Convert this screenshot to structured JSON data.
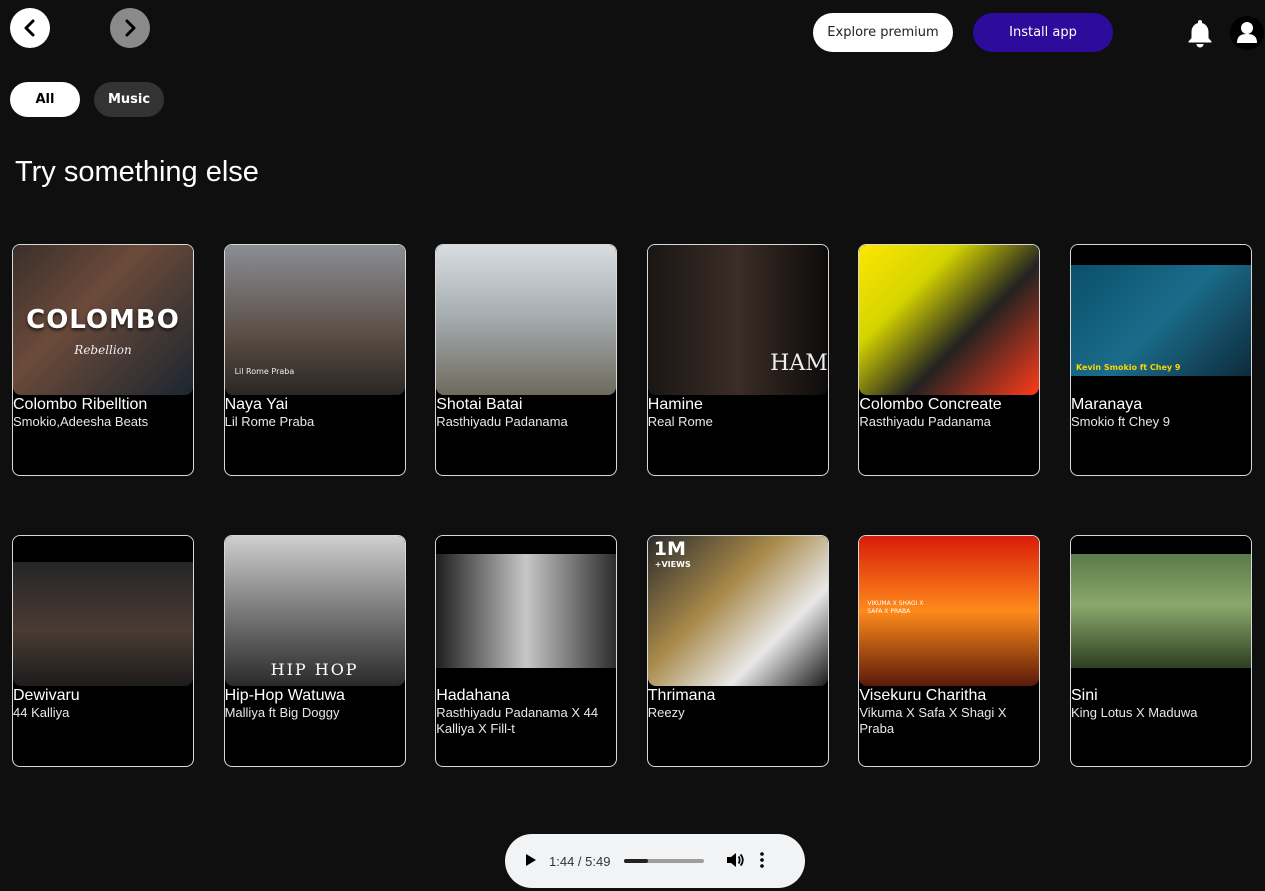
{
  "header": {
    "explore_label": "Explore premium",
    "install_label": "Install app"
  },
  "filters": {
    "all": "All",
    "music": "Music"
  },
  "section": {
    "title": "Try something else"
  },
  "cards": [
    {
      "title": "Colombo Ribelltion",
      "artist": "Smokio,Adeesha Beats",
      "cover_text": "COLOMBO",
      "cover_sub": "Rebellion",
      "bg": "linear-gradient(135deg,#3a2f2a,#6b4a3a 40%,#1b2630)"
    },
    {
      "title": "Naya Yai",
      "artist": "Lil Rome Praba",
      "cover_text": "",
      "cover_sub": "Lil Rome Praba",
      "bg": "linear-gradient(180deg,#8a8e94,#5a4e45 60%,#2b2622)"
    },
    {
      "title": "Shotai Batai",
      "artist": "Rasthiyadu Padanama",
      "cover_text": "",
      "cover_sub": "",
      "bg": "linear-gradient(180deg,#d9dde0,#a8b0b4 45%,#6e6a5c)"
    },
    {
      "title": "Hamine",
      "artist": "Real Rome",
      "cover_text": "HAM",
      "cover_sub": "",
      "bg": "linear-gradient(90deg,#1a1614,#3b2d27 50%,#0d0b0a)"
    },
    {
      "title": "Colombo Concreate",
      "artist": "Rasthiyadu Padanama",
      "cover_text": "",
      "cover_sub": "",
      "bg": "linear-gradient(135deg,#ffe600,#d4d400 30%,#222 60%,#ff3b1a)"
    },
    {
      "title": "Maranaya",
      "artist": "Smokio ft Chey 9",
      "cover_text": "",
      "cover_sub": "Kevin Smokio ft Chey 9",
      "bg": "linear-gradient(135deg,#0a4f6a,#1a6c8a 50%,#0e2a3a)"
    },
    {
      "title": "Dewivaru",
      "artist": "44 Kalliya",
      "cover_text": "",
      "cover_sub": "",
      "bg": "linear-gradient(180deg,#262626,#4a3b33 55%,#1c1c1c)"
    },
    {
      "title": "Hip-Hop Watuwa",
      "artist": "Malliya ft Big Doggy",
      "cover_text": "HIP HOP",
      "cover_sub": "",
      "bg": "linear-gradient(180deg,#cfcfcf,#7a7a7a 50%,#2a2a2a)"
    },
    {
      "title": "Hadahana",
      "artist": "Rasthiyadu Padanama X 44 Kalliya X Fill-t",
      "cover_text": "",
      "cover_sub": "",
      "bg": "linear-gradient(90deg,#1e1e1e,#c7c7c7 50%,#2c2c2c)"
    },
    {
      "title": "Thrimana",
      "artist": "Reezy",
      "cover_text": "1M",
      "cover_sub": "+VIEWS",
      "bg": "linear-gradient(135deg,#2b2b2b,#a88a4a 40%,#e8e8e8 70%,#1a1a1a)"
    },
    {
      "title": "Visekuru Charitha",
      "artist": "Vikuma X Safa X Shagi X Praba",
      "cover_text": "",
      "cover_sub": "VIKUMA X SHAGI X SAFA X PRABA",
      "bg": "linear-gradient(180deg,#d81c0a,#ff8a1a 50%,#5a1a0a)"
    },
    {
      "title": "Sini",
      "artist": "King Lotus X Maduwa",
      "cover_text": "",
      "cover_sub": "",
      "bg": "linear-gradient(180deg,#5a7a4a,#8aa86a 45%,#2e3e22)"
    }
  ],
  "player": {
    "time": "1:44 / 5:49",
    "progress": 0.3
  }
}
